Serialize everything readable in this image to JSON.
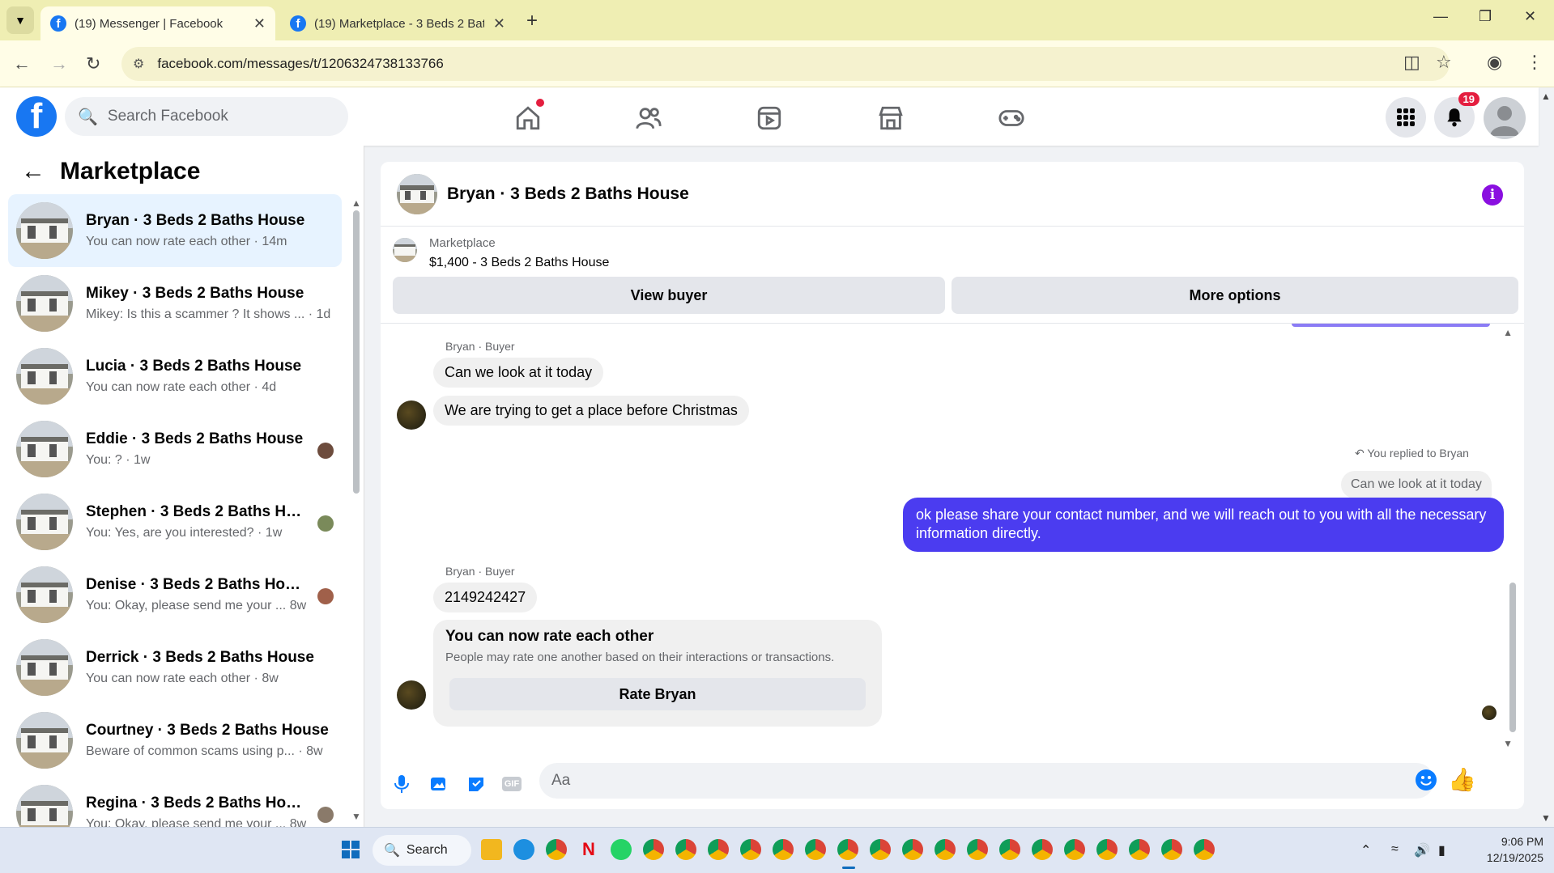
{
  "browser": {
    "tabs": [
      {
        "title": "(19) Messenger | Facebook",
        "active": true
      },
      {
        "title": "(19) Marketplace - 3 Beds 2 Bat",
        "active": false
      }
    ],
    "url": "facebook.com/messages/t/1206324738133766"
  },
  "fb_header": {
    "search_placeholder": "Search Facebook",
    "notification_count": "19"
  },
  "sidebar": {
    "title": "Marketplace",
    "conversations": [
      {
        "name": "Bryan · 3 Beds 2 Baths House",
        "preview": "You can now rate each other · 14m",
        "active": true
      },
      {
        "name": "Mikey · 3 Beds 2 Baths House",
        "preview": "Mikey: Is this a scammer ? It shows ... · 1d"
      },
      {
        "name": "Lucia · 3 Beds 2 Baths House",
        "preview": "You can now rate each other · 4d"
      },
      {
        "name": "Eddie · 3 Beds 2 Baths House",
        "preview": "You: ? · 1w"
      },
      {
        "name": "Stephen · 3 Beds 2 Baths House",
        "preview": "You: Yes, are you interested? · 1w"
      },
      {
        "name": "Denise · 3 Beds 2 Baths House",
        "preview": "You: Okay, please send me your ... 8w"
      },
      {
        "name": "Derrick · 3 Beds 2 Baths House",
        "preview": "You can now rate each other · 8w"
      },
      {
        "name": "Courtney · 3 Beds 2 Baths House",
        "preview": "Beware of common scams using p... · 8w"
      },
      {
        "name": "Regina · 3 Beds 2 Baths House",
        "preview": "You: Okay, please send me your ... 8w"
      }
    ]
  },
  "chat": {
    "title": "Bryan · 3 Beds 2 Baths House",
    "marketplace_label": "Marketplace",
    "listing": "$1,400 - 3 Beds 2 Baths House",
    "view_buyer": "View buyer",
    "more_options": "More options",
    "sender_label": "Bryan · Buyer",
    "msg1": "Can we look at it today",
    "msg2": "We are trying to get a place before Christmas",
    "reply_note": "You replied to Bryan",
    "quoted": "Can we look at it today",
    "out_msg": "ok please share your contact number, and we will reach out to you with all the necessary information directly.",
    "sender_label2": "Bryan · Buyer",
    "msg3": "2149242427",
    "rate_title": "You can now rate each other",
    "rate_desc": "People may rate one another based on their interactions or transactions.",
    "rate_button": "Rate Bryan",
    "composer_placeholder": "Aa"
  },
  "taskbar": {
    "search_label": "Search",
    "time": "9:06 PM",
    "date": "12/19/2025"
  },
  "colors": {
    "fb_blue": "#1877f2",
    "outgoing_bubble": "#4b3cf0",
    "notification_red": "#e41e3f"
  }
}
